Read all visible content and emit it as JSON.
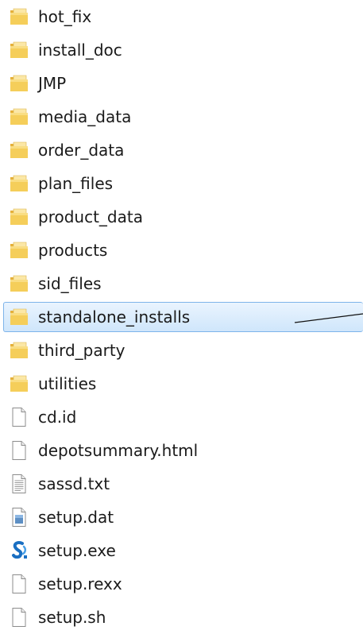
{
  "files": [
    {
      "name": "hot_fix",
      "type": "folder",
      "icon": "folder-icon"
    },
    {
      "name": "install_doc",
      "type": "folder",
      "icon": "folder-icon"
    },
    {
      "name": "JMP",
      "type": "folder",
      "icon": "folder-icon"
    },
    {
      "name": "media_data",
      "type": "folder",
      "icon": "folder-icon"
    },
    {
      "name": "order_data",
      "type": "folder",
      "icon": "folder-icon"
    },
    {
      "name": "plan_files",
      "type": "folder",
      "icon": "folder-icon"
    },
    {
      "name": "product_data",
      "type": "folder",
      "icon": "folder-icon"
    },
    {
      "name": "products",
      "type": "folder",
      "icon": "folder-icon"
    },
    {
      "name": "sid_files",
      "type": "folder",
      "icon": "folder-icon"
    },
    {
      "name": "standalone_installs",
      "type": "folder",
      "icon": "folder-icon",
      "selected": true
    },
    {
      "name": "third_party",
      "type": "folder",
      "icon": "folder-icon"
    },
    {
      "name": "utilities",
      "type": "folder",
      "icon": "folder-icon"
    },
    {
      "name": "cd.id",
      "type": "file",
      "icon": "blank-file-icon"
    },
    {
      "name": "depotsummary.html",
      "type": "file",
      "icon": "blank-file-icon"
    },
    {
      "name": "sassd.txt",
      "type": "file",
      "icon": "text-file-icon"
    },
    {
      "name": "setup.dat",
      "type": "file",
      "icon": "data-file-icon"
    },
    {
      "name": "setup.exe",
      "type": "file",
      "icon": "sas-app-icon"
    },
    {
      "name": "setup.rexx",
      "type": "file",
      "icon": "blank-file-icon"
    },
    {
      "name": "setup.sh",
      "type": "file",
      "icon": "blank-file-icon"
    }
  ],
  "colors": {
    "selection_background": "#cfe6fb",
    "selection_border": "#7eb4ea",
    "folder_yellow": "#f2c94c",
    "text": "#1a1a1a"
  }
}
